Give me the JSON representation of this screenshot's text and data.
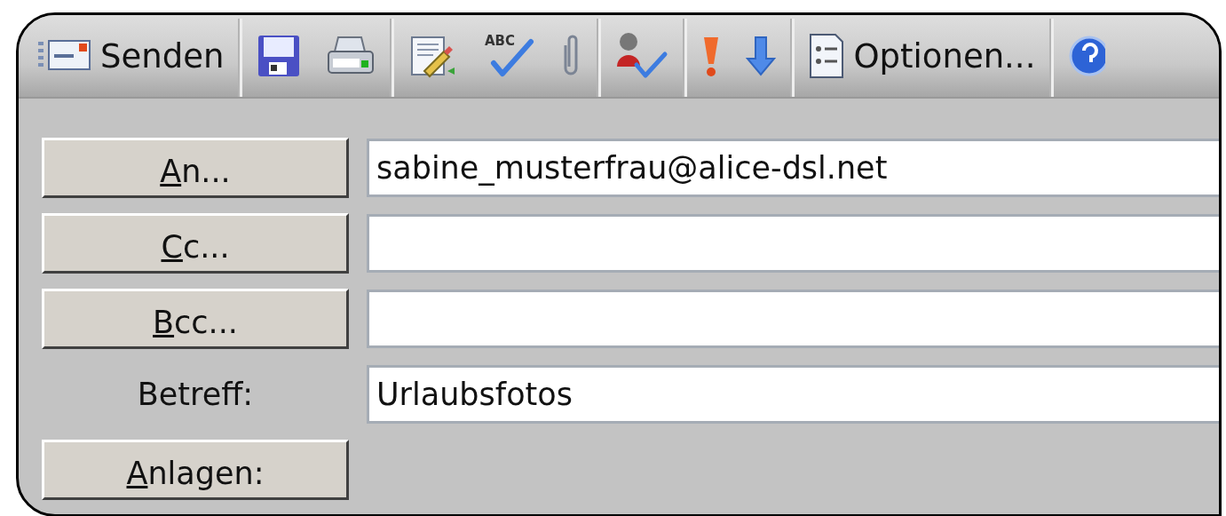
{
  "toolbar": {
    "items": [
      {
        "kind": "send",
        "label": "Senden"
      },
      {
        "kind": "separator"
      },
      {
        "kind": "save"
      },
      {
        "kind": "print"
      },
      {
        "kind": "separator"
      },
      {
        "kind": "signature"
      },
      {
        "kind": "spelling",
        "icon_text": "ABC"
      },
      {
        "kind": "attach"
      },
      {
        "kind": "separator"
      },
      {
        "kind": "check-names"
      },
      {
        "kind": "separator"
      },
      {
        "kind": "high-priority"
      },
      {
        "kind": "low-priority"
      },
      {
        "kind": "separator"
      },
      {
        "kind": "options",
        "label": "Optionen..."
      },
      {
        "kind": "separator"
      },
      {
        "kind": "help"
      }
    ]
  },
  "fields": [
    {
      "kind": "button",
      "label": "An...",
      "value": "sabine_musterfrau@alice-dsl.net"
    },
    {
      "kind": "button",
      "label": "Cc..."
    },
    {
      "kind": "button",
      "label": "Bcc..."
    },
    {
      "kind": "label",
      "label": "Betreff:",
      "value": "Urlaubsfotos"
    },
    {
      "kind": "button-only",
      "label": "Anlagen:"
    }
  ]
}
